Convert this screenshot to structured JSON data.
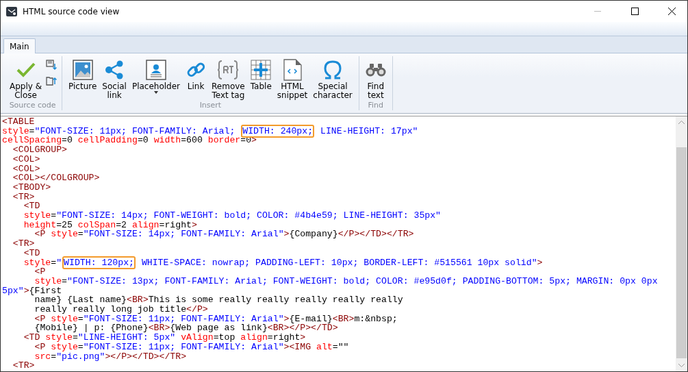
{
  "window": {
    "title": "HTML source code view"
  },
  "ribbon": {
    "tabs": [
      {
        "label": "Main",
        "selected": true
      }
    ],
    "groups": [
      {
        "label": "Source code",
        "buttons": [
          {
            "label": "Apply &\nClose",
            "dropdown": false
          }
        ]
      },
      {
        "label": "Insert",
        "buttons": [
          {
            "label": "Picture",
            "dropdown": false
          },
          {
            "label": "Social\nlink",
            "dropdown": false
          },
          {
            "label": "Placeholder",
            "dropdown": true
          },
          {
            "label": "Link",
            "dropdown": false
          },
          {
            "label": "Remove\nText tag",
            "dropdown": false
          },
          {
            "label": "Table",
            "dropdown": false
          },
          {
            "label": "HTML\nsnippet",
            "dropdown": false
          },
          {
            "label": "Special\ncharacter",
            "dropdown": false
          }
        ]
      },
      {
        "label": "Find",
        "buttons": [
          {
            "label": "Find\ntext",
            "dropdown": false
          }
        ]
      }
    ]
  },
  "code": {
    "lines": [
      [
        {
          "kind": "tag",
          "text": "<TABLE"
        }
      ],
      [
        {
          "kind": "attr",
          "text": "style"
        },
        {
          "kind": "text",
          "text": "="
        },
        {
          "kind": "val",
          "text": "\"FONT-SIZE: 11px; FONT-FAMILY: Arial; "
        },
        {
          "kind": "hl",
          "text": "WIDTH: 240px;"
        },
        {
          "kind": "val",
          "text": " LINE-HEIGHT: 17px\""
        }
      ],
      [
        {
          "kind": "attr",
          "text": "cellSpacing"
        },
        {
          "kind": "text",
          "text": "=0 "
        },
        {
          "kind": "attr",
          "text": "cellPadding"
        },
        {
          "kind": "text",
          "text": "=0 "
        },
        {
          "kind": "attr",
          "text": "width"
        },
        {
          "kind": "text",
          "text": "=600 "
        },
        {
          "kind": "attr",
          "text": "border"
        },
        {
          "kind": "text",
          "text": "=0"
        },
        {
          "kind": "tag",
          "text": ">"
        }
      ],
      [
        {
          "kind": "tag",
          "text": "  <COLGROUP>"
        }
      ],
      [
        {
          "kind": "tag",
          "text": "  <COL>"
        }
      ],
      [
        {
          "kind": "tag",
          "text": "  <COL>"
        }
      ],
      [
        {
          "kind": "tag",
          "text": "  <COL></COLGROUP>"
        }
      ],
      [
        {
          "kind": "tag",
          "text": "  <TBODY>"
        }
      ],
      [
        {
          "kind": "tag",
          "text": "  <TR>"
        }
      ],
      [
        {
          "kind": "tag",
          "text": "    <TD"
        }
      ],
      [
        {
          "kind": "attr",
          "text": "    style"
        },
        {
          "kind": "text",
          "text": "="
        },
        {
          "kind": "val",
          "text": "\"FONT-SIZE: 14px; FONT-WEIGHT: bold; COLOR: #4b4e59; LINE-HEIGHT: 35px\""
        }
      ],
      [
        {
          "kind": "attr",
          "text": "    height"
        },
        {
          "kind": "text",
          "text": "=25 "
        },
        {
          "kind": "attr",
          "text": "colSpan"
        },
        {
          "kind": "text",
          "text": "=2 "
        },
        {
          "kind": "attr",
          "text": "align"
        },
        {
          "kind": "text",
          "text": "=right"
        },
        {
          "kind": "tag",
          "text": ">"
        }
      ],
      [
        {
          "kind": "tag",
          "text": "      <P "
        },
        {
          "kind": "attr",
          "text": "style"
        },
        {
          "kind": "text",
          "text": "="
        },
        {
          "kind": "val",
          "text": "\"FONT-SIZE: 14px; FONT-FAMILY: Arial\""
        },
        {
          "kind": "tag",
          "text": ">"
        },
        {
          "kind": "text",
          "text": "{Company}"
        },
        {
          "kind": "tag",
          "text": "</P></TD></TR>"
        }
      ],
      [
        {
          "kind": "tag",
          "text": "  <TR>"
        }
      ],
      [
        {
          "kind": "tag",
          "text": "    <TD"
        }
      ],
      [
        {
          "kind": "attr",
          "text": "    style"
        },
        {
          "kind": "text",
          "text": "="
        },
        {
          "kind": "val",
          "text": "\""
        },
        {
          "kind": "hl",
          "text": "WIDTH: 120px;"
        },
        {
          "kind": "val",
          "text": " WHITE-SPACE: nowrap; PADDING-LEFT: 10px; BORDER-LEFT: #515561 10px solid\""
        },
        {
          "kind": "tag",
          "text": ">"
        }
      ],
      [
        {
          "kind": "tag",
          "text": "      <P"
        }
      ],
      [
        {
          "kind": "attr",
          "text": "      style"
        },
        {
          "kind": "text",
          "text": "="
        },
        {
          "kind": "val",
          "text": "\"FONT-SIZE: 13px; FONT-FAMILY: Arial; FONT-WEIGHT: bold; COLOR: #e95d0f; PADDING-BOTTOM: 5px; MARGIN: 0px 0px"
        }
      ],
      [
        {
          "kind": "val",
          "text": "5px\""
        },
        {
          "kind": "tag",
          "text": ">"
        },
        {
          "kind": "text",
          "text": "{First"
        }
      ],
      [
        {
          "kind": "text",
          "text": "      name} {Last name}"
        },
        {
          "kind": "tag",
          "text": "<BR>"
        },
        {
          "kind": "text",
          "text": "This is some really really really really really"
        }
      ],
      [
        {
          "kind": "text",
          "text": "      really really long job title"
        },
        {
          "kind": "tag",
          "text": "</P>"
        }
      ],
      [
        {
          "kind": "tag",
          "text": "      <P "
        },
        {
          "kind": "attr",
          "text": "style"
        },
        {
          "kind": "text",
          "text": "="
        },
        {
          "kind": "val",
          "text": "\"FONT-SIZE: 11px; FONT-FAMILY: Arial\""
        },
        {
          "kind": "tag",
          "text": ">"
        },
        {
          "kind": "text",
          "text": "{E-mail}"
        },
        {
          "kind": "tag",
          "text": "<BR>"
        },
        {
          "kind": "text",
          "text": "m:&nbsp;"
        }
      ],
      [
        {
          "kind": "text",
          "text": "      {Mobile} | p: {Phone}"
        },
        {
          "kind": "tag",
          "text": "<BR>"
        },
        {
          "kind": "text",
          "text": "{Web page as link}"
        },
        {
          "kind": "tag",
          "text": "<BR></P></TD>"
        }
      ],
      [
        {
          "kind": "tag",
          "text": "    <TD "
        },
        {
          "kind": "attr",
          "text": "style"
        },
        {
          "kind": "text",
          "text": "="
        },
        {
          "kind": "val",
          "text": "\"LINE-HEIGHT: 5px\" "
        },
        {
          "kind": "attr",
          "text": "vAlign"
        },
        {
          "kind": "text",
          "text": "=top "
        },
        {
          "kind": "attr",
          "text": "align"
        },
        {
          "kind": "text",
          "text": "=right"
        },
        {
          "kind": "tag",
          "text": ">"
        }
      ],
      [
        {
          "kind": "tag",
          "text": "      <P "
        },
        {
          "kind": "attr",
          "text": "style"
        },
        {
          "kind": "text",
          "text": "="
        },
        {
          "kind": "val",
          "text": "\"FONT-SIZE: 11px; FONT-FAMILY: Arial\""
        },
        {
          "kind": "tag",
          "text": "><IMG "
        },
        {
          "kind": "attr",
          "text": "alt"
        },
        {
          "kind": "text",
          "text": "=\"\""
        }
      ],
      [
        {
          "kind": "attr",
          "text": "      src"
        },
        {
          "kind": "text",
          "text": "="
        },
        {
          "kind": "val",
          "text": "\"pic.png\""
        },
        {
          "kind": "tag",
          "text": "></P></TD></TR>"
        }
      ],
      [
        {
          "kind": "tag",
          "text": "  <TR>"
        }
      ]
    ]
  }
}
